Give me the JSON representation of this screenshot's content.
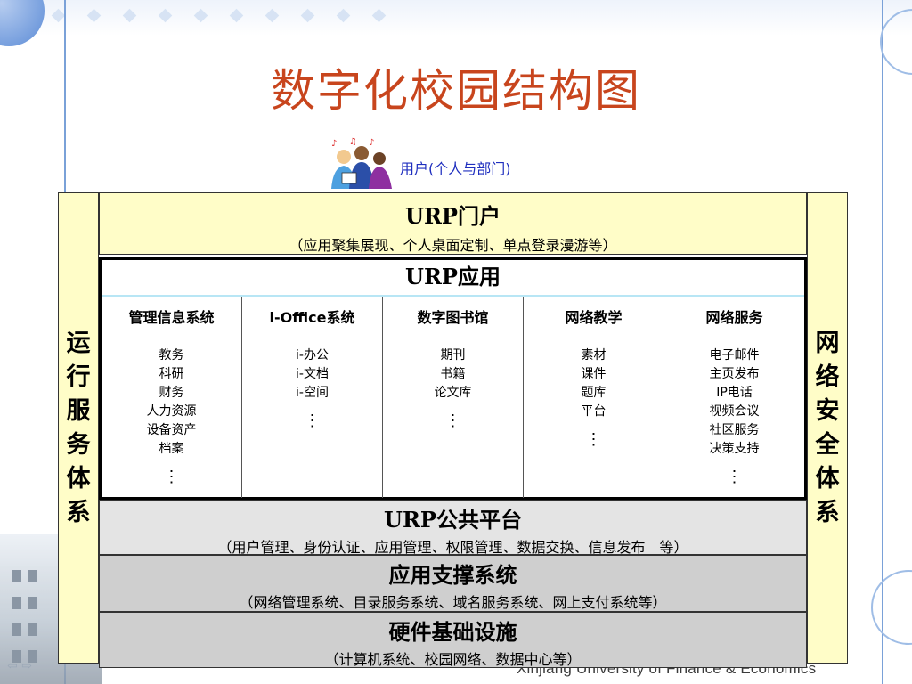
{
  "title": "数字化校园结构图",
  "users_label": "用户(个人与部门)",
  "sides": {
    "left": "运行服务体系",
    "right": "网络安全体系"
  },
  "portal": {
    "title": "URP门户",
    "subtitle": "（应用聚集展现、个人桌面定制、单点登录漫游等）"
  },
  "apps": {
    "title": "URP应用",
    "columns": [
      {
        "heading": "管理信息系统",
        "items": [
          "教务",
          "科研",
          "财务",
          "人力资源",
          "设备资产",
          "档案"
        ],
        "more": "⋮"
      },
      {
        "heading": "i-Office系统",
        "items": [
          "i-办公",
          "i-文档",
          "i-空间"
        ],
        "more": "⋮"
      },
      {
        "heading": "数字图书馆",
        "items": [
          "期刊",
          "书籍",
          "论文库"
        ],
        "more": "⋮"
      },
      {
        "heading": "网络教学",
        "items": [
          "素材",
          "课件",
          "题库",
          "平台"
        ],
        "more": "⋮"
      },
      {
        "heading": "网络服务",
        "items": [
          "电子邮件",
          "主页发布",
          "IP电话",
          "视频会议",
          "社区服务",
          "决策支持"
        ],
        "more": "⋮"
      }
    ]
  },
  "layers": [
    {
      "title": "URP公共平台",
      "subtitle": "（用户管理、身份认证、应用管理、权限管理、数据交换、信息发布　等）"
    },
    {
      "title": "应用支撑系统",
      "subtitle": "（网络管理系统、目录服务系统、域名服务系统、网上支付系统等）"
    },
    {
      "title": "硬件基础设施",
      "subtitle": "（计算机系统、校园网络、数据中心等）"
    }
  ],
  "footer": "Xinjiang University of Finance & Economics",
  "colors": {
    "title": "#c8451d",
    "user_label": "#1f2fbf",
    "yellow": "#fffdc8",
    "gray_light": "#e4e4e4",
    "gray": "#cfcfcf"
  }
}
